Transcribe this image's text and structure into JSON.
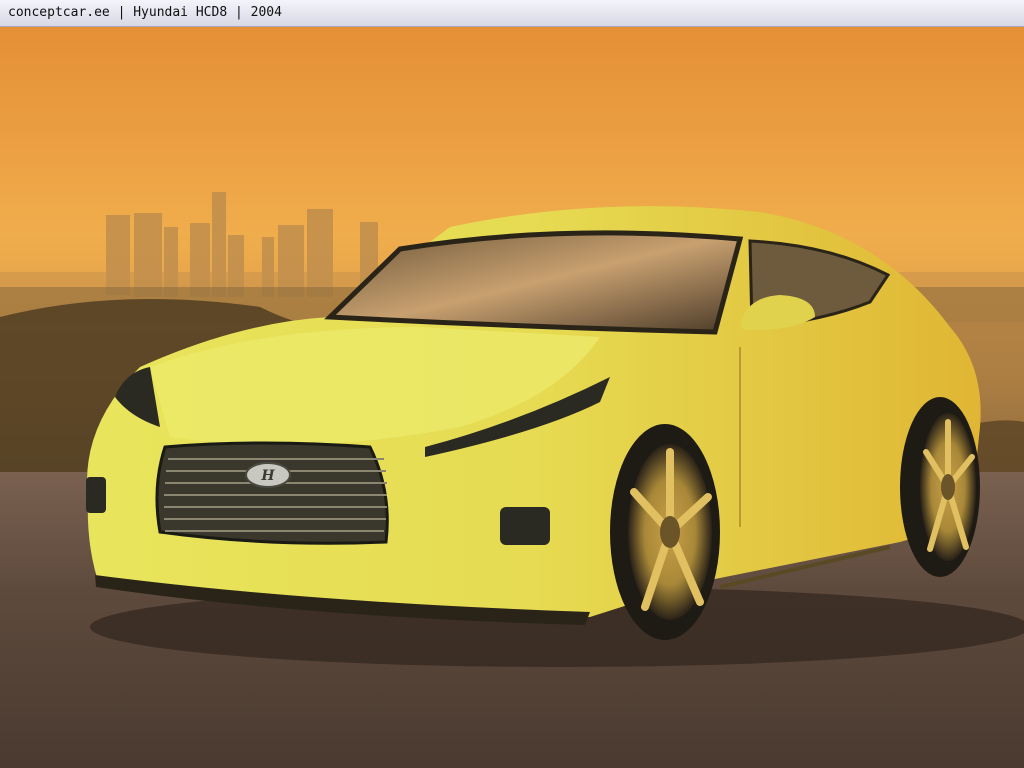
{
  "window": {
    "title": "conceptcar.ee | Hyundai HCD8 | 2004"
  },
  "photo": {
    "subject-icon": "yellow-concept-coupe",
    "colors": {
      "sky_top": "#e79a3a",
      "sky_horizon": "#f0b048",
      "car_body": "#e3dc52",
      "ground": "#5c4a3c"
    }
  }
}
